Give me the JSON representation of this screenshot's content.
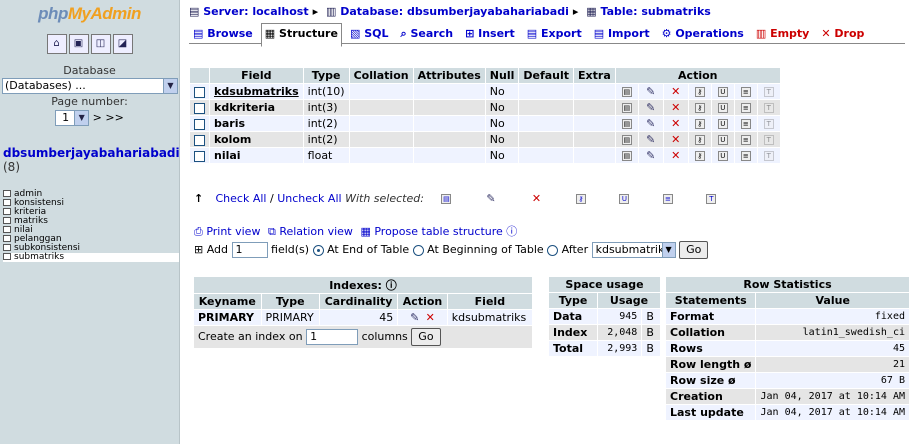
{
  "nav": {
    "logo_a": "php",
    "logo_b": "MyAdmin",
    "quick_icons": [
      "home-icon",
      "sql-window-icon",
      "docs-icon",
      "query-icon"
    ],
    "database_label": "Database",
    "database_select": "(Databases) ...",
    "page_label": "Page number:",
    "page_value": "1",
    "page_next": "> >>",
    "db_name": "dbsumberjayabahariabadi",
    "db_count": "(8)",
    "tables": [
      "admin",
      "konsistensi",
      "kriteria",
      "matriks",
      "nilai",
      "pelanggan",
      "subkonsistensi",
      "submatriks"
    ],
    "selected_table": "submatriks"
  },
  "crumb": {
    "server": "Server: localhost",
    "database": "Database: dbsumberjayabahariabadi",
    "table": "Table: submatriks"
  },
  "tabs": [
    "Browse",
    "Structure",
    "SQL",
    "Search",
    "Insert",
    "Export",
    "Import",
    "Operations",
    "Empty",
    "Drop"
  ],
  "structure": {
    "headers": [
      "Field",
      "Type",
      "Collation",
      "Attributes",
      "Null",
      "Default",
      "Extra",
      "Action"
    ],
    "rows": [
      {
        "field": "kdsubmatriks",
        "type": "int(10)",
        "null": "No"
      },
      {
        "field": "kdkriteria",
        "type": "int(3)",
        "null": "No"
      },
      {
        "field": "baris",
        "type": "int(2)",
        "null": "No"
      },
      {
        "field": "kolom",
        "type": "int(2)",
        "null": "No"
      },
      {
        "field": "nilai",
        "type": "float",
        "null": "No"
      }
    ]
  },
  "bulk": {
    "check_all": "Check All",
    "sep": "/",
    "uncheck_all": "Uncheck All",
    "with_selected": "With selected:"
  },
  "links": {
    "print_view": "Print view",
    "relation_view": "Relation view",
    "propose": "Propose table structure"
  },
  "add_field": {
    "add": "Add",
    "count": "1",
    "fields": "field(s)",
    "end": "At End of Table",
    "beginning": "At Beginning of Table",
    "after": "After",
    "after_field": "kdsubmatriks",
    "go": "Go"
  },
  "indexes": {
    "title": "Indexes:",
    "headers": [
      "Keyname",
      "Type",
      "Cardinality",
      "Action",
      "Field"
    ],
    "row": {
      "keyname": "PRIMARY",
      "type": "PRIMARY",
      "cardinality": "45",
      "field": "kdsubmatriks"
    },
    "create_label": "Create an index on",
    "create_value": "1",
    "columns": "columns",
    "go": "Go"
  },
  "space": {
    "title": "Space usage",
    "headers": [
      "Type",
      "Usage"
    ],
    "rows": [
      {
        "type": "Data",
        "usage": "945",
        "unit": "B"
      },
      {
        "type": "Index",
        "usage": "2,048",
        "unit": "B"
      },
      {
        "type": "Total",
        "usage": "2,993",
        "unit": "B"
      }
    ]
  },
  "rowstats": {
    "title": "Row Statistics",
    "headers": [
      "Statements",
      "Value"
    ],
    "rows": [
      {
        "k": "Format",
        "v": "fixed"
      },
      {
        "k": "Collation",
        "v": "latin1_swedish_ci"
      },
      {
        "k": "Rows",
        "v": "45"
      },
      {
        "k": "Row length ø",
        "v": "21"
      },
      {
        "k": "Row size ø",
        "v": "67 B"
      },
      {
        "k": "Creation",
        "v": "Jan 04, 2017 at 10:14 AM"
      },
      {
        "k": "Last update",
        "v": "Jan 04, 2017 at 10:14 AM"
      }
    ]
  }
}
